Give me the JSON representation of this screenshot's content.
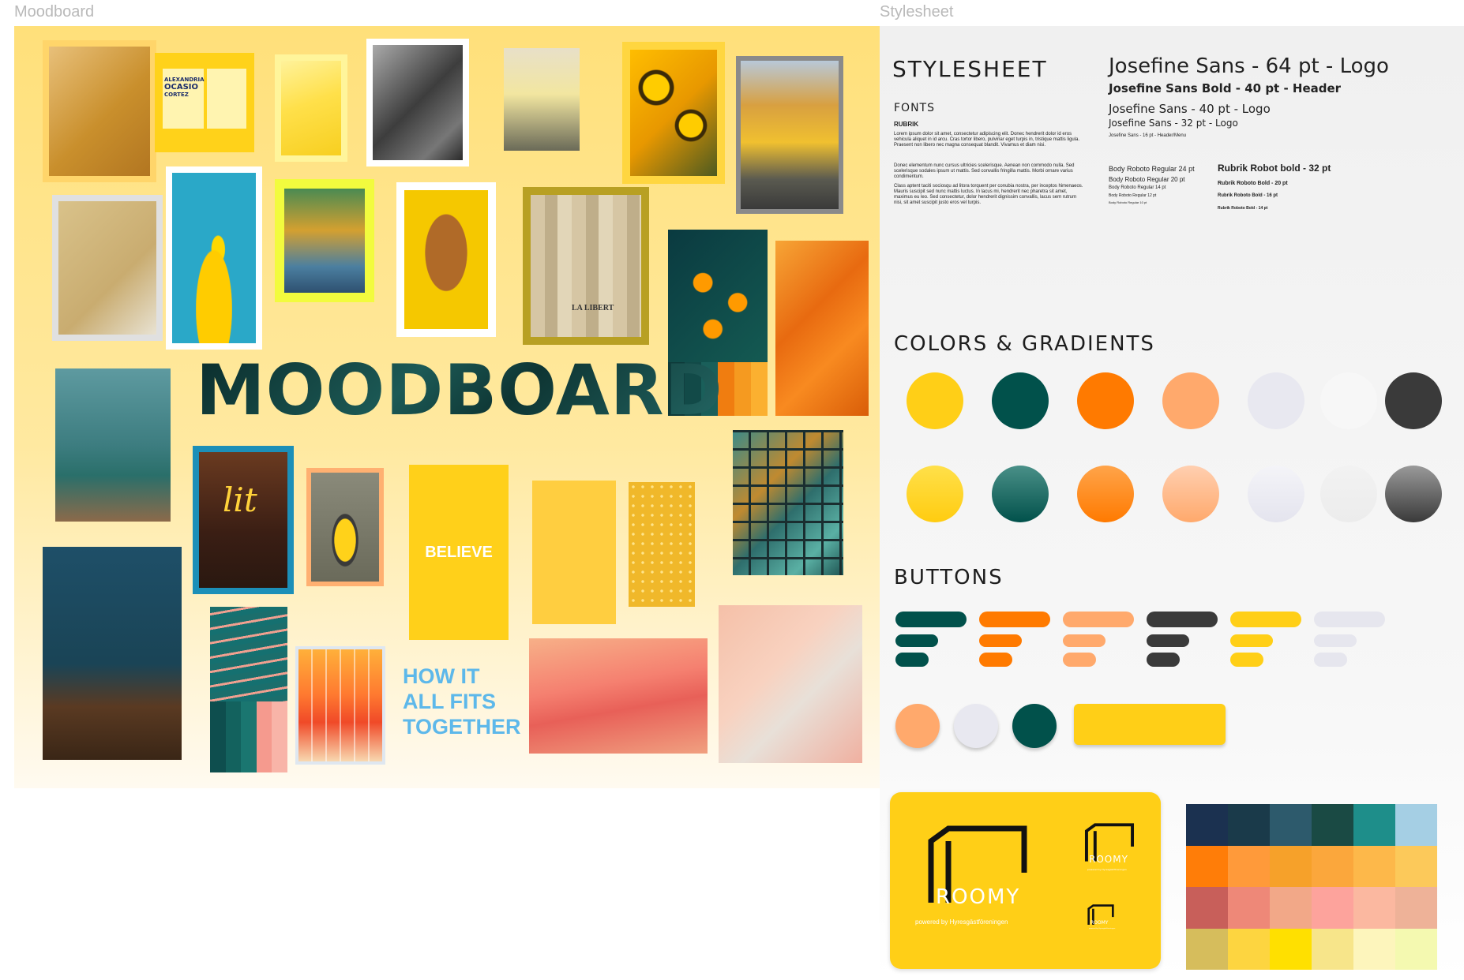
{
  "frames": {
    "moodboard_label": "Moodboard",
    "stylesheet_label": "Stylesheet"
  },
  "moodboard": {
    "title": "MOODBOARD",
    "tagline_lines": [
      "HOW IT",
      "ALL FITS",
      "TOGETHER"
    ],
    "poster_text": [
      "ALEXANDRIA",
      "OCASIO",
      "CORTEZ"
    ],
    "neon_text": "lit",
    "believe_text": "BELIEVE",
    "newspaper_text": "LA LIBERT"
  },
  "stylesheet": {
    "title": "STYLESHEET",
    "fonts_label": "FONTS",
    "rubrik_label": "RUBRIK",
    "lorem1": "Lorem ipsum dolor sit amet, consectetur adipiscing elit. Donec hendrerit dolor id eros vehicula aliquet in id arcu. Cras tortor libero, pulvinar eget turpis in, tristique mattis ligula. Praesent non libero nec magna consequat blandit. Vivamus et diam nisi.",
    "lorem2": "Donec elementum nunc cursus ultricies scelerisque. Aenean non commodo nulla. Sed scelerisque sodales ipsum ut mattis. Sed convallis fringilla mattis. Morbi ornare varius condimentum.",
    "lorem3": "Class aptent taciti sociosqu ad litora torquent per conubia nostra, per inceptos himenaeos. Mauris suscipit sed nunc mattis luctus. In lacus mi, hendrerit nec pharetra sit amet, maximus eu leo. Sed consectetur, dolor hendrerit dignissim convallis, lacus sem rutrum nisi, sit amet suscipit justo eros vel turpis.",
    "typescale": [
      {
        "text": "Josefine Sans - 64 pt - Logo"
      },
      {
        "text": "Josefine Sans Bold - 40 pt - Header"
      },
      {
        "text": "Josefine Sans - 40 pt - Logo"
      },
      {
        "text": "Josefine Sans - 32 pt - Logo"
      },
      {
        "text": "Josefine Sans - 16 pt - Header/Menu"
      }
    ],
    "body_scale": [
      "Body Roboto Regular 24 pt",
      "Body Roboto Regular 20 pt",
      "Body Roboto Regular 14 pt",
      "Body Roboto Regular 12 pt",
      "Body Roboto Regular 10 pt"
    ],
    "rubrik_scale": [
      "Rubrik Robot bold - 32 pt",
      "Rubrik Roboto Bold - 20 pt",
      "Rubrik Roboto Bold - 16 pt",
      "Rubrik Roboto Bold - 14 pt"
    ],
    "colors_heading": "COLORS & GRADIENTS",
    "solid_colors": [
      "#ffcf17",
      "#01514b",
      "#ff7a00",
      "#ffa96c",
      "#e8e8f0",
      "#f7f7f7",
      "#3a3a3a"
    ],
    "buttons_heading": "BUTTONS",
    "button_colors": [
      "#01514b",
      "#ff7a00",
      "#ffa96c",
      "#3a3a3a",
      "#ffcf17",
      "#e6e6ee"
    ],
    "logo": {
      "name": "ROOMY",
      "tagline": "powered by Hyresgästföreningen"
    },
    "palette": [
      [
        "#1b3150",
        "#1a3a4a",
        "#2d5a6c",
        "#1a4a44",
        "#1e8e8a",
        "#a5cfe4"
      ],
      [
        "#ff7d08",
        "#ff9a3a",
        "#f6a12a",
        "#fba73c",
        "#fdb84a",
        "#fcc95a"
      ],
      [
        "#c85f5a",
        "#ee8878",
        "#f2a888",
        "#fda39c",
        "#fbb8a0",
        "#eeb298"
      ],
      [
        "#d6bd5c",
        "#fdd540",
        "#ffe000",
        "#f7e58a",
        "#fdf5bc",
        "#f4f9b0"
      ]
    ]
  }
}
